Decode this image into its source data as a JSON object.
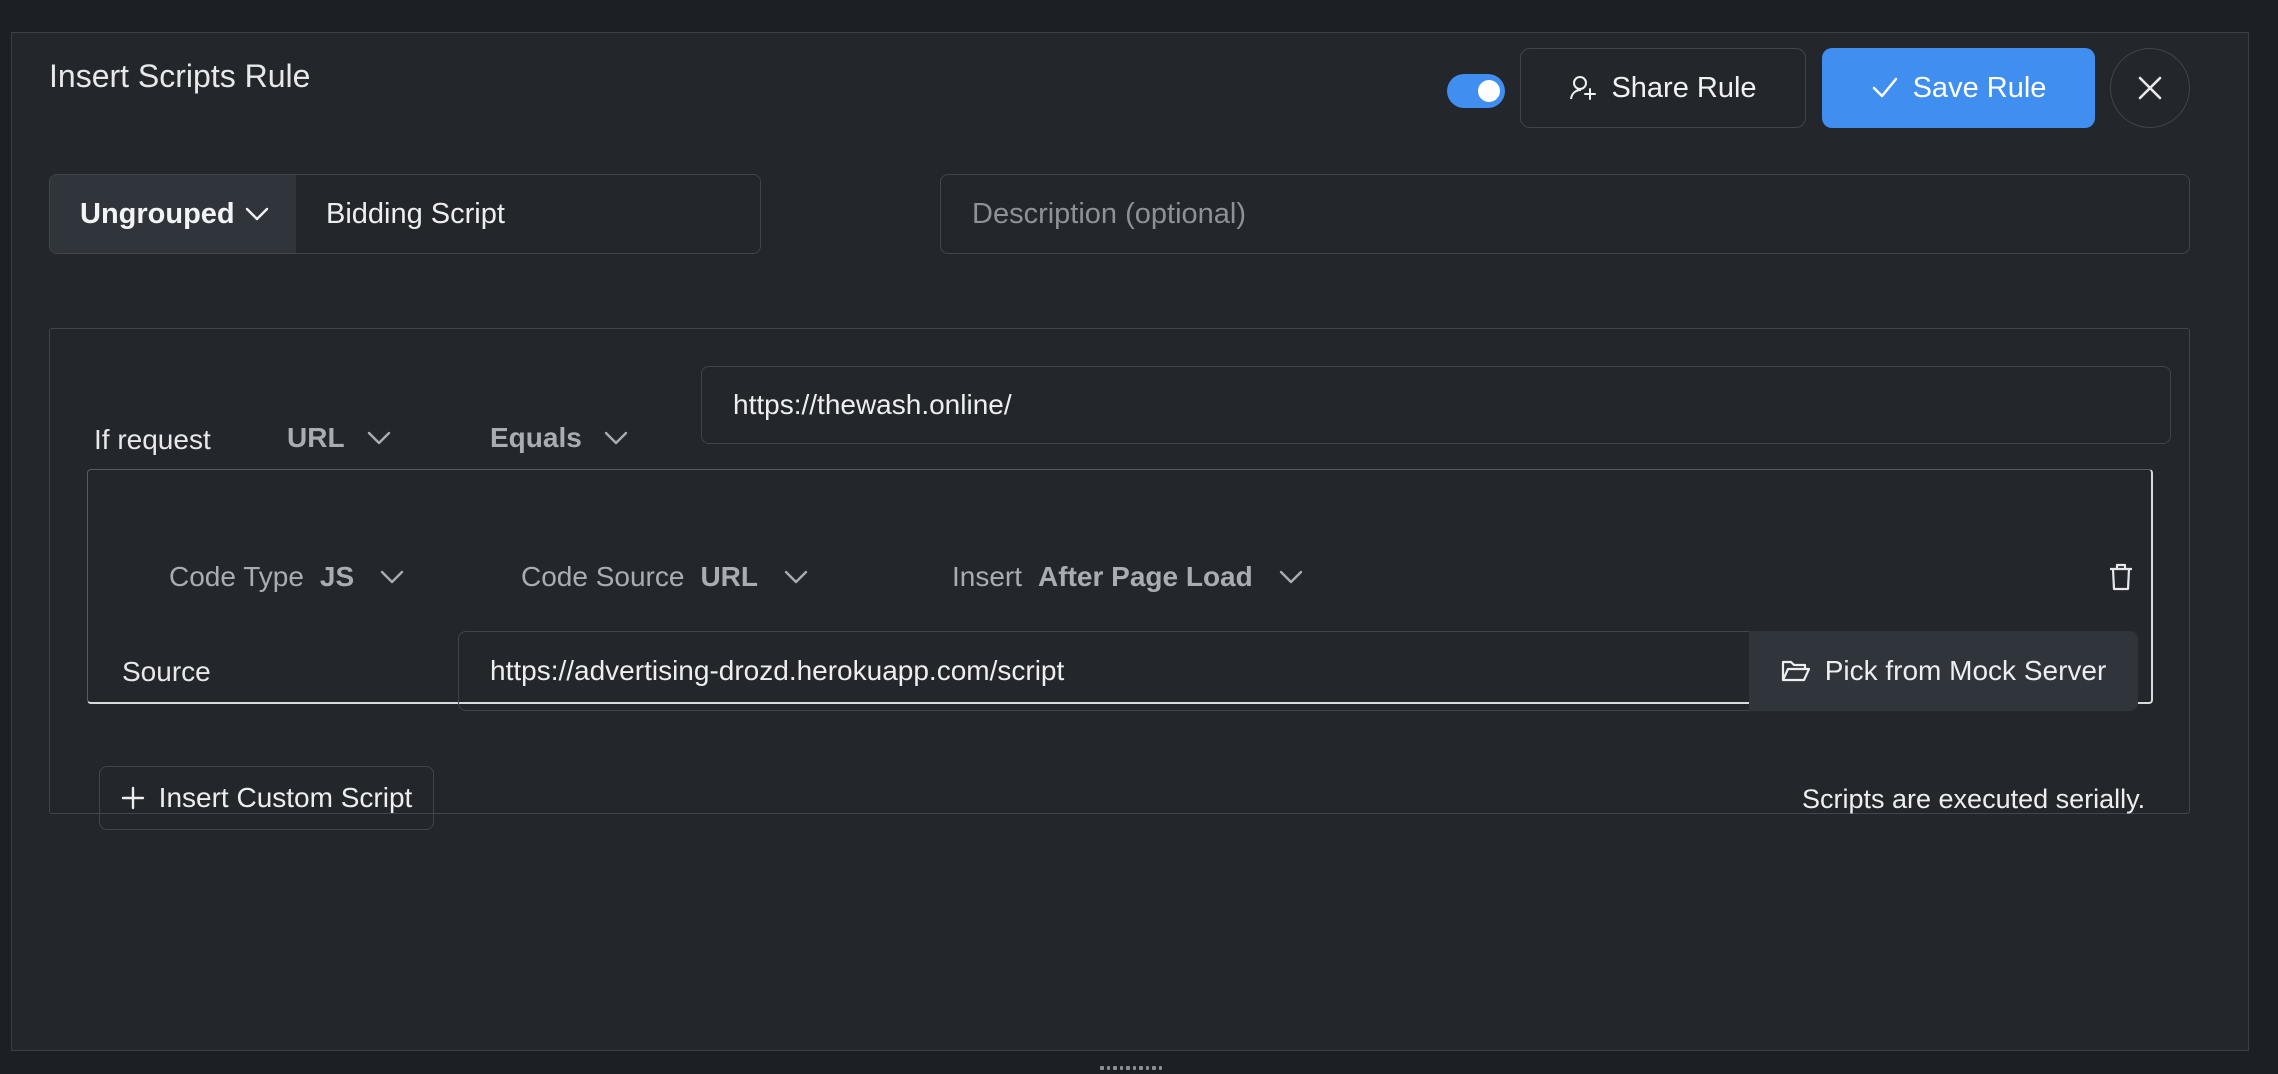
{
  "header": {
    "title": "Insert Scripts Rule",
    "toggle_on": true,
    "share_label": "Share Rule",
    "save_label": "Save Rule"
  },
  "rule_meta": {
    "group": "Ungrouped",
    "name": "Bidding Script",
    "description_placeholder": "Description (optional)"
  },
  "condition": {
    "label": "If request",
    "field": "URL",
    "operator": "Equals",
    "value": "https://thewash.online/"
  },
  "script": {
    "code_type_label": "Code Type",
    "code_type": "JS",
    "code_source_label": "Code Source",
    "code_source": "URL",
    "insert_label": "Insert",
    "insert_when": "After Page Load",
    "source_label": "Source",
    "source_value": "https://advertising-drozd.herokuapp.com/script",
    "mock_button": "Pick from Mock Server"
  },
  "footer": {
    "insert_button": "Insert Custom Script",
    "note": "Scripts are executed serially."
  },
  "colors": {
    "accent": "#3f8ef0",
    "background": "#23262b"
  }
}
